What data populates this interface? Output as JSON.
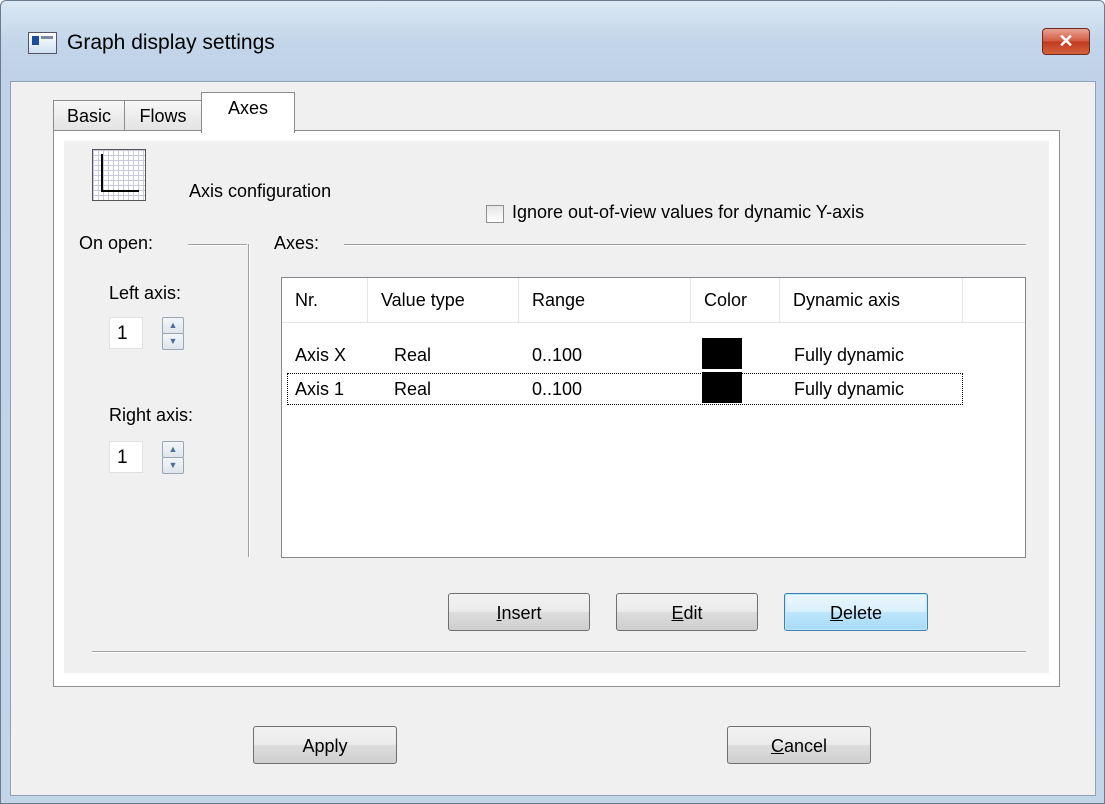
{
  "window": {
    "title": "Graph display settings",
    "close_glyph": "✕"
  },
  "tabs": [
    {
      "label": "Basic",
      "active": false
    },
    {
      "label": "Flows",
      "active": false
    },
    {
      "label": "Axes",
      "active": true
    }
  ],
  "axes_tab": {
    "icon": "axis-grid-icon",
    "section_title": "Axis configuration",
    "ignore_checkbox": {
      "label": "Ignore out-of-view values for dynamic Y-axis",
      "checked": false
    },
    "on_open": {
      "group_label": "On open:",
      "left_axis": {
        "label": "Left axis:",
        "value": "1"
      },
      "right_axis": {
        "label": "Right axis:",
        "value": "1"
      }
    },
    "axes_group_label": "Axes:",
    "table": {
      "columns": [
        "Nr.",
        "Value type",
        "Range",
        "Color",
        "Dynamic axis"
      ],
      "rows": [
        {
          "nr": "Axis X",
          "value_type": "Real",
          "range": "0..100",
          "color": "#000000",
          "dynamic": "Fully dynamic"
        },
        {
          "nr": "Axis 1",
          "value_type": "Real",
          "range": "0..100",
          "color": "#000000",
          "dynamic": "Fully dynamic"
        }
      ]
    },
    "buttons": {
      "insert": {
        "mnemonic": "I",
        "rest": "nsert"
      },
      "edit": {
        "mnemonic": "E",
        "rest": "dit"
      },
      "delete": {
        "mnemonic": "D",
        "rest": "elete"
      }
    }
  },
  "footer": {
    "apply": "Apply",
    "cancel": {
      "mnemonic": "C",
      "rest": "ancel"
    }
  }
}
